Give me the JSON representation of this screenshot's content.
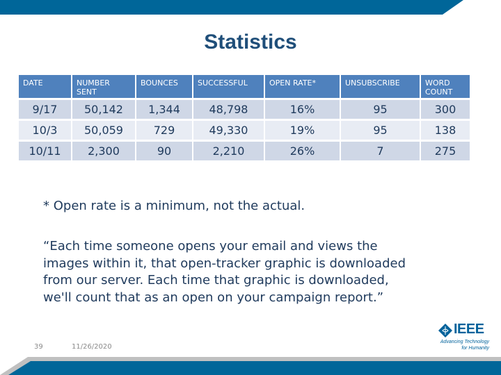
{
  "slide": {
    "title": "Statistics",
    "page_number": "39",
    "date": "11/26/2020"
  },
  "colors": {
    "banner_blue": "#006699",
    "banner_gray": "#c0c0c0",
    "header_blue": "#4f81bd",
    "row_odd": "#cfd7e6",
    "row_even": "#e8ecf4",
    "text_dark": "#1f3a5c"
  },
  "table": {
    "headers": [
      [
        "DATE"
      ],
      [
        "NUMBER",
        "SENT"
      ],
      [
        "BOUNCES"
      ],
      [
        "SUCCESSFUL"
      ],
      [
        "OPEN RATE*"
      ],
      [
        "UNSUBSCRIBE"
      ],
      [
        "WORD",
        "COUNT"
      ]
    ],
    "rows": [
      [
        "9/17",
        "50,142",
        "1,344",
        "48,798",
        "16%",
        "95",
        "300"
      ],
      [
        "10/3",
        "50,059",
        "729",
        "49,330",
        "19%",
        "95",
        "138"
      ],
      [
        "10/11",
        "2,300",
        "90",
        "2,210",
        "26%",
        "7",
        "275"
      ]
    ]
  },
  "footnote": "* Open rate is a minimum, not the actual.",
  "quote_lines": [
    "“Each time someone opens your email and views the",
    "images within it, that open-tracker graphic is downloaded",
    "from our server. Each time that graphic is downloaded,",
    "we'll count that as an open on your campaign report.”"
  ],
  "logo": {
    "icon": "ieee-diamond-icon",
    "name": "IEEE",
    "tagline_lines": [
      "Advancing Technology",
      "for Humanity"
    ]
  }
}
